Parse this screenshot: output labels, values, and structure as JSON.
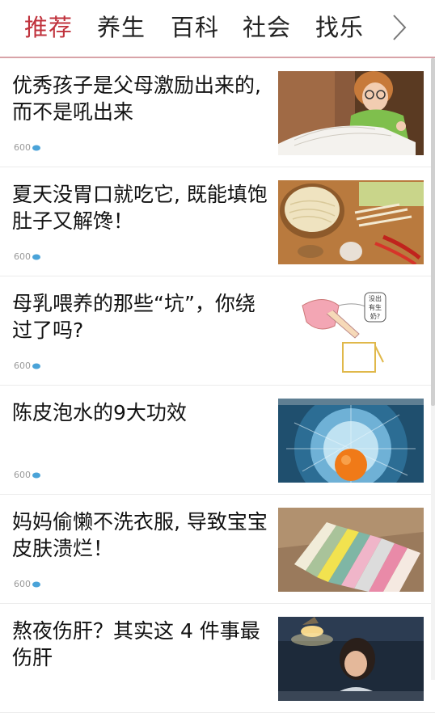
{
  "tabs": [
    {
      "label": "推荐",
      "active": true
    },
    {
      "label": "养生",
      "active": false
    },
    {
      "label": "百科",
      "active": false
    },
    {
      "label": "社会",
      "active": false
    },
    {
      "label": "找乐",
      "active": false
    }
  ],
  "more_icon": "chevron-right-icon",
  "colors": {
    "accent": "#c0323c",
    "divider": "#d8a3a8",
    "text": "#111111",
    "meta": "#999999"
  },
  "articles": [
    {
      "title": "优秀孩子是父母激励出来的, 而不是吼出来",
      "views": "600",
      "image": "child-reading-book-photo"
    },
    {
      "title": "夏天没胃口就吃它, 既能填饱肚子又解馋！",
      "views": "600",
      "image": "noodles-and-vegetables-photo"
    },
    {
      "title": "母乳喂养的那些“坑”，你绕过了吗?",
      "views": "600",
      "image": "breastfeeding-cartoon-illustration",
      "image_text": "没出有生奶?"
    },
    {
      "title": "陈皮泡水的9大功效",
      "views": "600",
      "image": "orange-in-water-photo"
    },
    {
      "title": "妈妈偷懒不洗衣服, 导致宝宝皮肤溃烂！",
      "views": "600",
      "image": "folded-baby-clothes-photo"
    },
    {
      "title": "熬夜伤肝？其实这 4 件事最伤肝",
      "views": "",
      "image": "tired-woman-at-desk-photo"
    }
  ]
}
